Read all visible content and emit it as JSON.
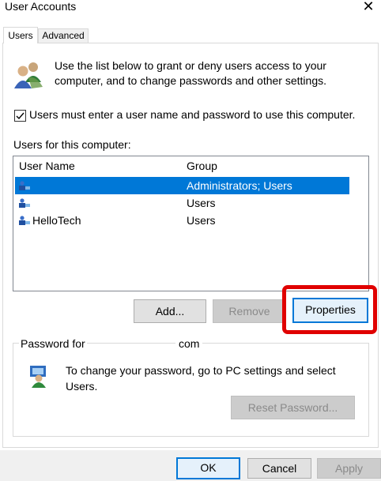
{
  "window": {
    "title": "User Accounts",
    "close_glyph": "✕"
  },
  "tabs": [
    {
      "label": "Users",
      "selected": true
    },
    {
      "label": "Advanced",
      "selected": false
    }
  ],
  "info_text": "Use the list below to grant or deny users access to your computer, and to change passwords and other settings.",
  "checkbox": {
    "label": "Users must enter a user name and password to use this computer.",
    "checked": true
  },
  "users_label": "Users for this computer:",
  "list": {
    "columns": [
      "User Name",
      "Group"
    ],
    "rows": [
      {
        "name": "",
        "group": "Administrators; Users",
        "selected": true
      },
      {
        "name": "",
        "group": "Users",
        "selected": false
      },
      {
        "name": "HelloTech",
        "group": "Users",
        "selected": false
      }
    ]
  },
  "buttons": {
    "add": "Add...",
    "remove": "Remove",
    "properties": "Properties"
  },
  "password_group": {
    "title": "Password for",
    "title_suffix": "com",
    "text": "To change your password, go to PC settings and select Users.",
    "reset_button": "Reset Password..."
  },
  "dialog_buttons": {
    "ok": "OK",
    "cancel": "Cancel",
    "apply": "Apply"
  },
  "colors": {
    "selection": "#0078d7",
    "highlight": "#e00000",
    "disabled_text": "#8a8a8a"
  },
  "icons": [
    "users-icon",
    "user-icon",
    "user-key-icon",
    "close-icon",
    "checkmark-icon"
  ]
}
